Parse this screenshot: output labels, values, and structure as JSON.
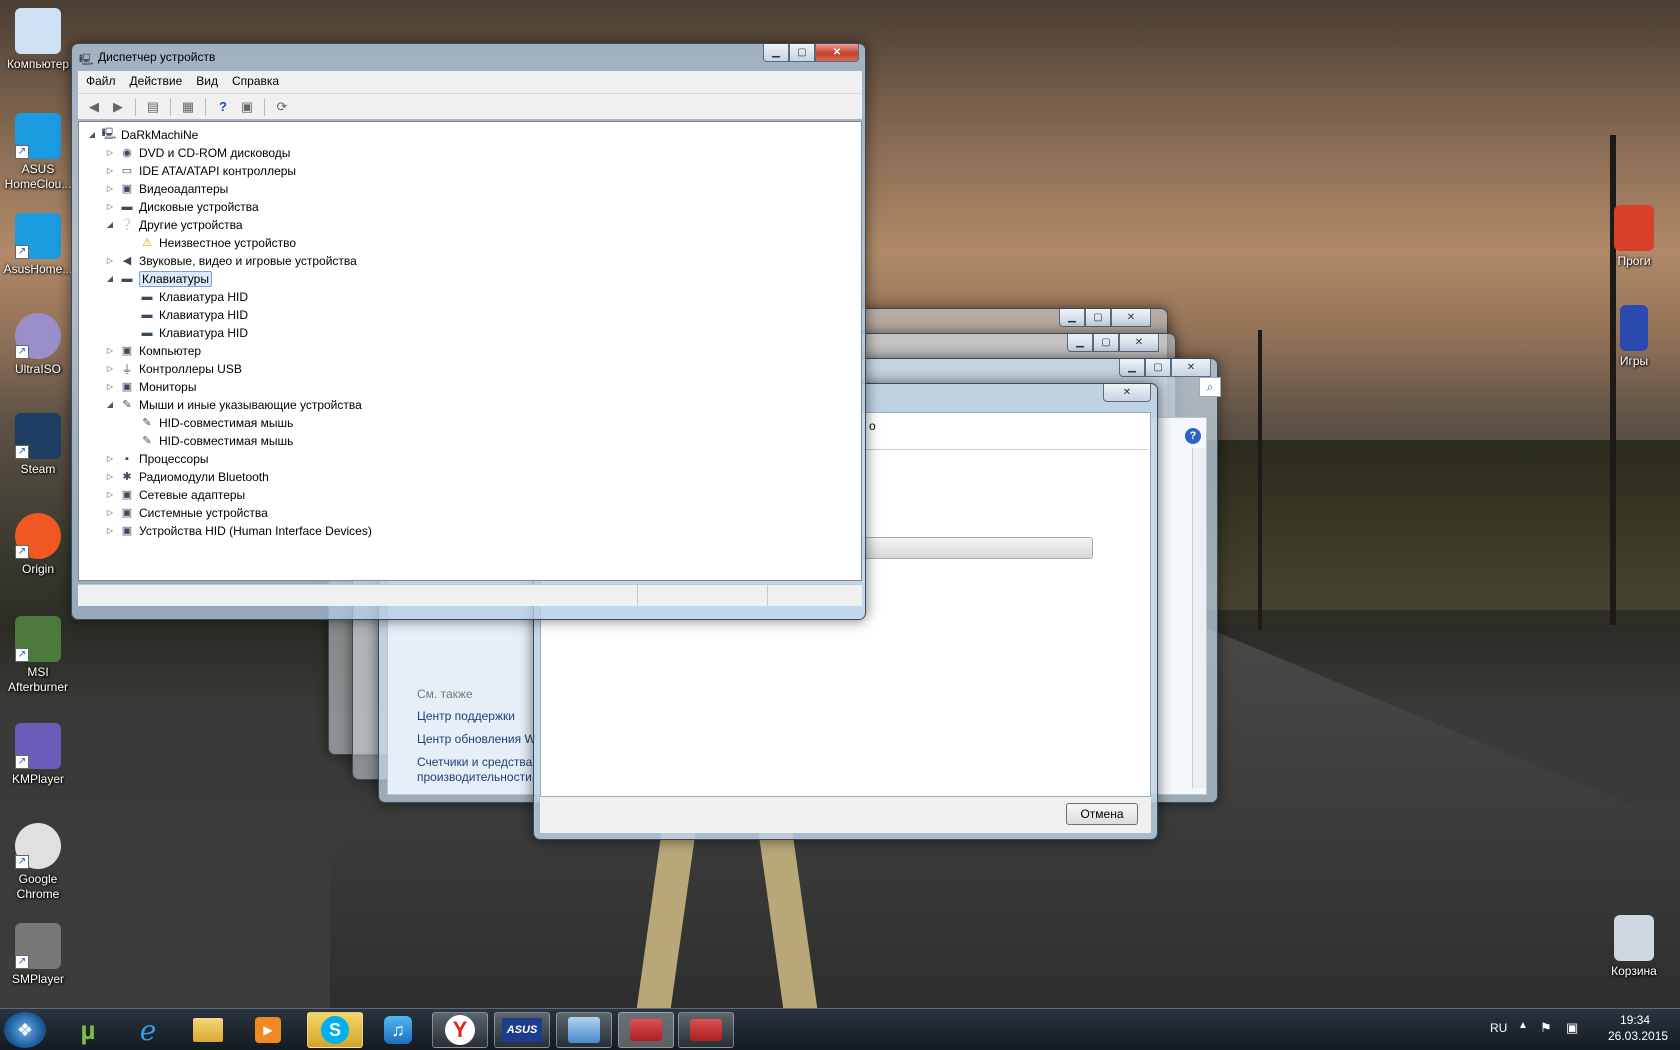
{
  "desktop": {
    "left_icons": [
      {
        "label": "Компьютер",
        "icon": "computer-icon"
      },
      {
        "label": "ASUS HomeClou...",
        "icon": "cloud-icon"
      },
      {
        "label": "AsusHome...",
        "icon": "cloud-icon"
      },
      {
        "label": "UltraISO",
        "icon": "disc-icon"
      },
      {
        "label": "Steam",
        "icon": "steam-icon"
      },
      {
        "label": "Origin",
        "icon": "origin-icon"
      },
      {
        "label": "MSI Afterburner",
        "icon": "afterburner-icon"
      },
      {
        "label": "KMPlayer",
        "icon": "kmplayer-icon"
      },
      {
        "label": "Google Chrome",
        "icon": "chrome-icon"
      },
      {
        "label": "SMPlayer",
        "icon": "smplayer-icon"
      }
    ],
    "right_icons": [
      {
        "label": "Проги",
        "icon": "folder-icon"
      },
      {
        "label": "Игры",
        "icon": "game-icon"
      },
      {
        "label": "Корзина",
        "icon": "recycle-bin-icon"
      }
    ]
  },
  "device_manager": {
    "title": "Диспетчер устройств",
    "menu": [
      "Файл",
      "Действие",
      "Вид",
      "Справка"
    ],
    "root": "DaRkMachiNe",
    "tree": [
      {
        "label": "DVD и CD-ROM дисководы",
        "level": 1,
        "expanded": false
      },
      {
        "label": "IDE ATA/ATAPI контроллеры",
        "level": 1,
        "expanded": false
      },
      {
        "label": "Видеоадаптеры",
        "level": 1,
        "expanded": false
      },
      {
        "label": "Дисковые устройства",
        "level": 1,
        "expanded": false
      },
      {
        "label": "Другие устройства",
        "level": 1,
        "expanded": true
      },
      {
        "label": "Неизвестное устройство",
        "level": 2,
        "warning": true
      },
      {
        "label": "Звуковые, видео и игровые устройства",
        "level": 1,
        "expanded": false
      },
      {
        "label": "Клавиатуры",
        "level": 1,
        "expanded": true,
        "selected": true
      },
      {
        "label": "Клавиатура HID",
        "level": 2
      },
      {
        "label": "Клавиатура HID",
        "level": 2
      },
      {
        "label": "Клавиатура HID",
        "level": 2
      },
      {
        "label": "Компьютер",
        "level": 1,
        "expanded": false
      },
      {
        "label": "Контроллеры USB",
        "level": 1,
        "expanded": false
      },
      {
        "label": "Мониторы",
        "level": 1,
        "expanded": false
      },
      {
        "label": "Мыши и иные указывающие устройства",
        "level": 1,
        "expanded": true
      },
      {
        "label": "HID-совместимая мышь",
        "level": 2
      },
      {
        "label": "HID-совместимая мышь",
        "level": 2
      },
      {
        "label": "Процессоры",
        "level": 1,
        "expanded": false
      },
      {
        "label": "Радиомодули Bluetooth",
        "level": 1,
        "expanded": false
      },
      {
        "label": "Сетевые адаптеры",
        "level": 1,
        "expanded": false
      },
      {
        "label": "Системные устройства",
        "level": 1,
        "expanded": false
      },
      {
        "label": "Устройства HID (Human Interface Devices)",
        "level": 1,
        "expanded": false
      }
    ]
  },
  "background_window": {
    "see_also": "См. также",
    "links": [
      "Центр поддержки",
      "Центр обновления W",
      "Счетчики и средства производительности"
    ]
  },
  "dialog": {
    "partial_text": "о",
    "cancel_label": "Отмена"
  },
  "tray": {
    "language": "RU",
    "time": "19:34",
    "date": "26.03.2015"
  }
}
